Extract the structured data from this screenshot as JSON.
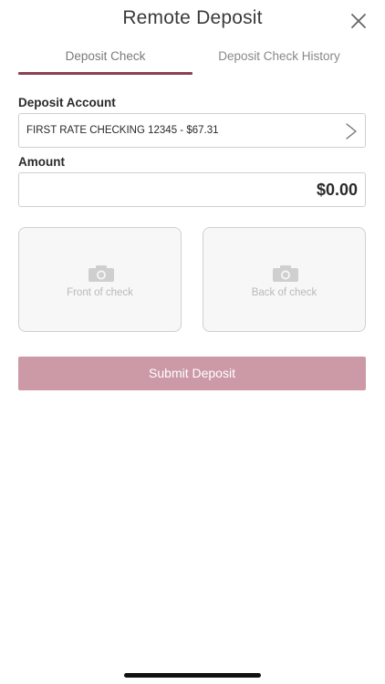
{
  "header": {
    "title": "Remote Deposit",
    "close_icon": "close-icon"
  },
  "tabs": [
    {
      "label": "Deposit Check",
      "active": true
    },
    {
      "label": "Deposit Check History",
      "active": false
    }
  ],
  "form": {
    "account_label": "Deposit Account",
    "account_value": "FIRST RATE CHECKING 12345 - $67.31",
    "amount_label": "Amount",
    "amount_value": "$0.00"
  },
  "checks": {
    "front_label": "Front of check",
    "back_label": "Back of check",
    "icon": "camera-icon"
  },
  "submit_label": "Submit Deposit",
  "colors": {
    "accent": "#8a3f52",
    "submit_disabled": "#cc99a6",
    "placeholder_gray": "#b9b9b9"
  }
}
